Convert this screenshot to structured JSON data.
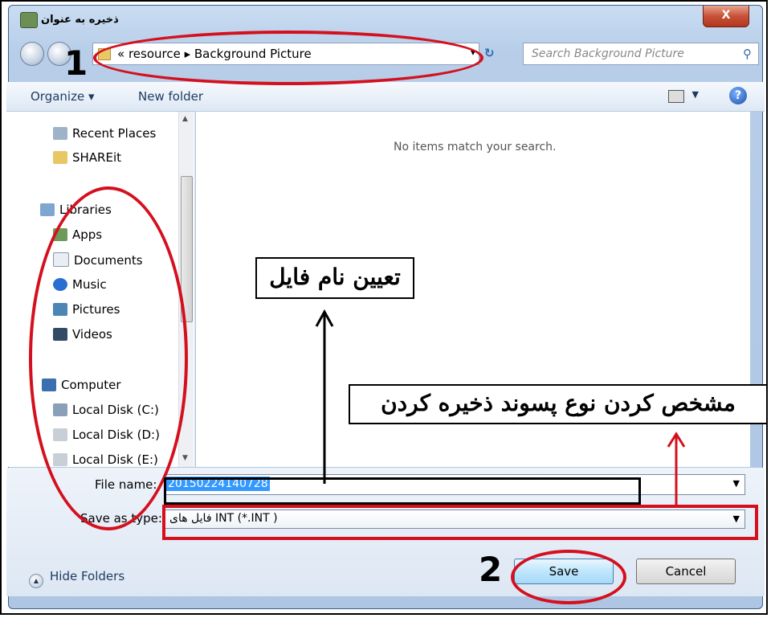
{
  "window": {
    "title": "ذخیره به عنوان",
    "close_label": "X"
  },
  "address": {
    "path": "« resource ▸ Background Picture",
    "dropdown": "▾"
  },
  "search": {
    "placeholder": "Search Background Picture"
  },
  "toolbar": {
    "organize": "Organize ▾",
    "new_folder": "New folder",
    "help": "?"
  },
  "nav": {
    "items": [
      {
        "label": "Recent Places"
      },
      {
        "label": "SHAREit"
      },
      {
        "label": "Libraries"
      },
      {
        "label": "Apps"
      },
      {
        "label": "Documents"
      },
      {
        "label": "Music"
      },
      {
        "label": "Pictures"
      },
      {
        "label": "Videos"
      },
      {
        "label": "Computer"
      },
      {
        "label": "Local Disk (C:)"
      },
      {
        "label": "Local Disk (D:)"
      },
      {
        "label": "Local Disk (E:)"
      }
    ]
  },
  "content": {
    "empty_message": "No items match your search."
  },
  "form": {
    "file_name_label": "File name:",
    "file_name_value": "20150224140728",
    "save_type_label": "Save as type:",
    "save_type_value": "فایل های INT (*.INT )"
  },
  "footer": {
    "hide_folders": "Hide Folders",
    "save": "Save",
    "cancel": "Cancel"
  },
  "annotations": {
    "num1": "1",
    "num2": "2",
    "file_name_note": "تعیین نام فایل",
    "type_note": "مشخص کردن نوع پسوند ذخیره کردن"
  },
  "colors": {
    "annotation_red": "#d4101e",
    "selection_blue": "#3399ff"
  }
}
